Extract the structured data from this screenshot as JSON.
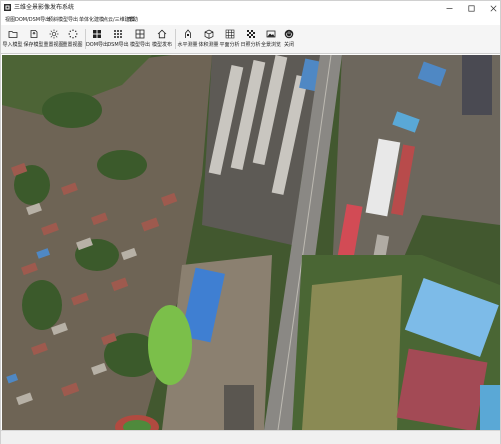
{
  "window": {
    "title": "三维全景影像发布系统",
    "controls": {
      "minimize": "minimize-icon",
      "maximize": "maximize-icon",
      "close": "close-icon"
    }
  },
  "menu": [
    {
      "label": "视图"
    },
    {
      "label": "DOM/DSM导出"
    },
    {
      "label": "倾斜模型导出"
    },
    {
      "label": "单体化建模"
    },
    {
      "label": "点云/三维建模"
    },
    {
      "label": "帮助"
    }
  ],
  "toolbar": [
    {
      "label": "导入模型",
      "icon": "folder-icon"
    },
    {
      "label": "保存模型",
      "icon": "save-icon"
    },
    {
      "label": "重置视图",
      "icon": "sun-icon"
    },
    {
      "label": "重置视图",
      "icon": "loading-icon"
    },
    {
      "label": "DOM导出",
      "icon": "grid-icon"
    },
    {
      "label": "DSM导出",
      "icon": "dots-grid-icon"
    },
    {
      "label": "模型导出",
      "icon": "grid-icon"
    },
    {
      "label": "模型发布",
      "icon": "home-icon"
    },
    {
      "label": "水平测量",
      "icon": "ruler-icon"
    },
    {
      "label": "体积测量",
      "icon": "cube-icon"
    },
    {
      "label": "平面分析",
      "icon": "grid-icon"
    },
    {
      "label": "日照分析",
      "icon": "checker-icon"
    },
    {
      "label": "全景浏览",
      "icon": "panorama-icon"
    },
    {
      "label": "关闭",
      "icon": "power-icon"
    }
  ],
  "colors": {
    "titlebar_bg": "#ffffff",
    "toolbar_bg": "#f5f5f5",
    "statusbar_bg": "#f0f0f0",
    "map_green": "#3d5a2c"
  }
}
